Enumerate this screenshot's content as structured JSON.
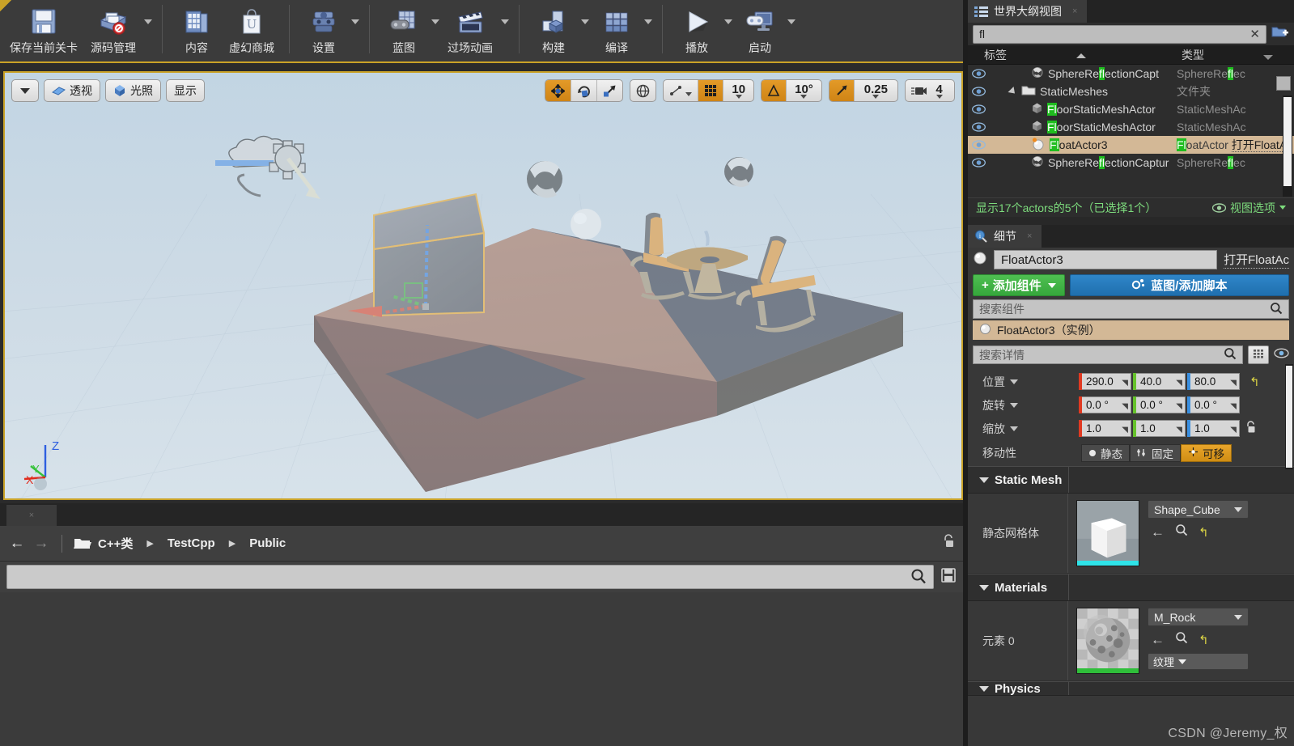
{
  "toolbar": {
    "groups": [
      {
        "buttons": [
          {
            "label": "保存当前关卡",
            "icon": "save-icon",
            "caret": false
          },
          {
            "label": "源码管理",
            "icon": "source-control-icon",
            "caret": true
          }
        ]
      },
      {
        "buttons": [
          {
            "label": "内容",
            "icon": "content-browser-icon",
            "caret": false
          },
          {
            "label": "虚幻商城",
            "icon": "marketplace-icon",
            "caret": false
          }
        ]
      },
      {
        "buttons": [
          {
            "label": "设置",
            "icon": "settings-gear-icon",
            "caret": true
          }
        ]
      },
      {
        "buttons": [
          {
            "label": "蓝图",
            "icon": "blueprint-icon",
            "caret": true
          },
          {
            "label": "过场动画",
            "icon": "cinematics-clapper-icon",
            "caret": true
          }
        ]
      },
      {
        "buttons": [
          {
            "label": "构建",
            "icon": "build-icon",
            "caret": true
          },
          {
            "label": "编译",
            "icon": "compile-icon",
            "caret": true
          }
        ]
      },
      {
        "buttons": [
          {
            "label": "播放",
            "icon": "play-triangle-icon",
            "caret": true
          },
          {
            "label": "启动",
            "icon": "launch-monitor-icon",
            "caret": true
          }
        ]
      }
    ]
  },
  "viewport": {
    "left_controls": {
      "menu_caret": "view-menu-caret",
      "perspective_label": "透视",
      "lit_label": "光照",
      "show_label": "显示"
    },
    "transform_tools": {
      "translate": "move-gizmo-icon",
      "rotate": "rotate-gizmo-icon",
      "scale": "scale-gizmo-icon",
      "active": "translate"
    },
    "coord_space": "world-globe-icon",
    "surface_snap": "surface-snap-icon",
    "grid_snap_enabled": true,
    "grid_snap_value": "10",
    "angle_snap_enabled": true,
    "angle_snap_value": "10°",
    "scale_snap_enabled": true,
    "scale_snap_value": "0.25",
    "camera_speed_value": "4",
    "axis_labels": {
      "x": "X",
      "y": "Y",
      "z": "Z"
    }
  },
  "content_browser": {
    "tab_close": "×",
    "nav_back": "←",
    "nav_forward": "→",
    "folder_icon": "folder-open-icon",
    "breadcrumbs": [
      "C++类",
      "TestCpp",
      "Public"
    ],
    "breadcrumb_sep": "▶",
    "lock_icon": "unlock-icon",
    "search_placeholder": "",
    "search_icon": "search-icon",
    "save_icon": "save-disk-icon"
  },
  "outliner": {
    "tab_title": "世界大纲视图",
    "tab_icon": "outliner-list-icon",
    "tab_close": "×",
    "search_value": "fl",
    "search_clear": "✕",
    "add_folder_icon": "new-folder-icon",
    "columns": {
      "label": "标签",
      "type": "类型"
    },
    "rows": [
      {
        "name_pre": "SphereRe",
        "name_hl": "fl",
        "name_post": "ectionCapt",
        "type_pre": "SphereRe",
        "type_hl": "fl",
        "type_post": "ec",
        "icon": "sphere-reflection-icon",
        "indent": 2,
        "selected": false,
        "extra": ""
      },
      {
        "name_pre": "StaticMeshes",
        "name_hl": "",
        "name_post": "",
        "type_pre": "文件夹",
        "type_hl": "",
        "type_post": "",
        "icon": "folder-icon",
        "indent": 1,
        "selected": false,
        "extra": ""
      },
      {
        "name_pre": "",
        "name_hl": "Fl",
        "name_post": "oorStaticMeshActor",
        "type_pre": "StaticMeshAc",
        "type_hl": "",
        "type_post": "",
        "icon": "static-mesh-icon",
        "indent": 2,
        "selected": false,
        "extra": ""
      },
      {
        "name_pre": "",
        "name_hl": "Fl",
        "name_post": "oorStaticMeshActor",
        "type_pre": "StaticMeshAc",
        "type_hl": "",
        "type_post": "",
        "icon": "static-mesh-icon",
        "indent": 2,
        "selected": false,
        "extra": ""
      },
      {
        "name_pre": "",
        "name_hl": "Fl",
        "name_post": "oatActor3",
        "type_pre": "",
        "type_hl": "Fl",
        "type_post": "oatActor",
        "icon": "float-actor-icon",
        "indent": 2,
        "selected": true,
        "extra": "打开FloatAc"
      },
      {
        "name_pre": "SphereRe",
        "name_hl": "fl",
        "name_post": "ectionCaptur",
        "type_pre": "SphereRe",
        "type_hl": "fl",
        "type_post": "ec",
        "icon": "sphere-reflection-icon",
        "indent": 2,
        "selected": false,
        "extra": ""
      }
    ],
    "status": "显示17个actors的5个（已选择1个）",
    "view_options": "视图选项",
    "view_options_icon": "eye-icon"
  },
  "details": {
    "tab_title": "细节",
    "tab_icon": "details-info-icon",
    "tab_close": "×",
    "actor_name": "FloatActor3",
    "open_link": "打开FloatAc",
    "add_component": "添加组件",
    "add_component_plus": "+",
    "blueprint_button": "蓝图/添加脚本",
    "blueprint_icon": "blueprint-gear-icon",
    "component_search_placeholder": "搜索组件",
    "component_search_icon": "search-icon",
    "component_item": "FloatActor3（实例）",
    "details_search_placeholder": "搜索详情",
    "details_search_icon": "search-icon",
    "grid_view_icon": "grid-view-icon",
    "eye_icon": "eye-icon",
    "transform": {
      "position_label": "位置",
      "position": [
        "290.0",
        "40.0",
        "80.0"
      ],
      "rotation_label": "旋转",
      "rotation": [
        "0.0 °",
        "0.0 °",
        "0.0 °"
      ],
      "scale_label": "缩放",
      "scale": [
        "1.0",
        "1.0",
        "1.0"
      ],
      "reset_icon": "reset-arrow-icon",
      "lock_icon": "lock-ratio-icon"
    },
    "mobility": {
      "label": "移动性",
      "options": [
        {
          "label": "静态",
          "icon": "static-dot-icon",
          "active": false
        },
        {
          "label": "固定",
          "icon": "stationary-icon",
          "active": false
        },
        {
          "label": "可移",
          "icon": "movable-icon",
          "active": true
        }
      ]
    },
    "static_mesh_section": {
      "title": "Static Mesh",
      "row_label": "静态网格体",
      "asset_name": "Shape_Cube",
      "thumbnail": "cube-thumbnail",
      "browse_icon": "browse-back-icon",
      "find_icon": "search-icon",
      "reset_icon": "reset-arrow-icon"
    },
    "materials_section": {
      "title": "Materials",
      "row_label": "元素 0",
      "asset_name": "M_Rock",
      "thumbnail": "rock-material-thumbnail",
      "browse_icon": "browse-back-icon",
      "find_icon": "search-icon",
      "reset_icon": "reset-arrow-icon",
      "texture_button": "纹理"
    },
    "physics_section_partial": "Physics"
  },
  "watermark": "CSDN @Jeremy_权",
  "colors": {
    "accent_gold": "#c9a227",
    "selection": "#d3b896",
    "highlight_green": "#1fbd1f",
    "status_green": "#7ddc7d",
    "blue_button": "#2f86c9",
    "green_button": "#4fbf51",
    "axis_x": "#e03a22",
    "axis_y": "#66c22c",
    "axis_z": "#3a8fe0"
  }
}
